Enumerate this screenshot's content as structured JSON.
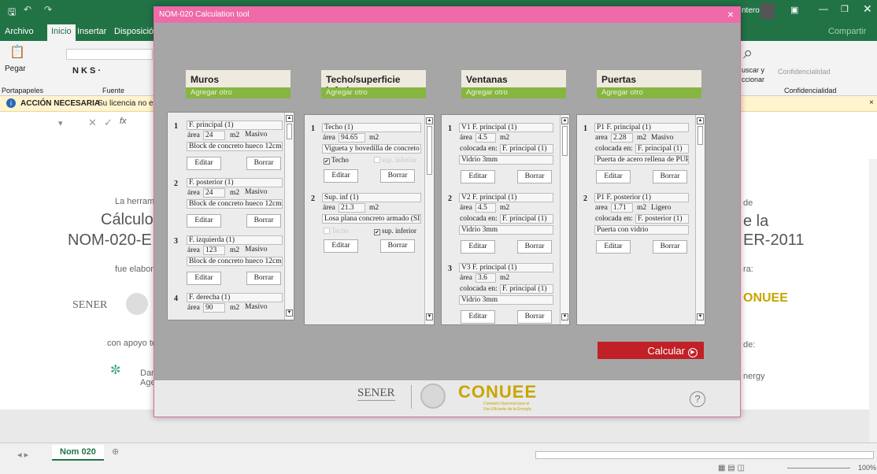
{
  "excel": {
    "tabs": [
      "Archivo",
      "Inicio",
      "Insertar",
      "Disposición d"
    ],
    "ribbon": {
      "pegar": "Pegar",
      "fuente": "Fuente",
      "portapapeles": "Portapapeles",
      "buscar1": "uscar y",
      "buscar2": "ccionar",
      "confidencialidad": "Confidencialidad",
      "confid2": "Confidencialidad",
      "compartir": "Compartir",
      "user": "ntero"
    },
    "warning": {
      "bold": "ACCIÓN NECESARIA",
      "text": "Su licencia no es o"
    },
    "sheet": {
      "l1": "La herrami",
      "l2": "Cálculo",
      "l3": "NOM-020-E",
      "l4": "fue elabora",
      "l5": "con apoyo té",
      "l6": "Dan",
      "l7": "Age",
      "r1": "de",
      "r2": "e la",
      "r3": "ER-2011",
      "r4": "ra:",
      "r5": "de:",
      "r6": "nergy",
      "sener": "SENER",
      "conuee": "ONUEE"
    },
    "sheet_tab": "Nom 020",
    "zoom": "100%"
  },
  "dialog": {
    "title": "NOM-020 Calculation tool",
    "close": "×",
    "calcular": "Calcular",
    "help": "?",
    "footer_sener": "SENER",
    "footer_conuee": "CONUEE",
    "footer_conuee_sub1": "Comisión Nacional para el",
    "footer_conuee_sub2": "Uso Eficiente de la Energía",
    "muros": {
      "title": "Muros",
      "add": "Agregar otro",
      "items": [
        {
          "n": "1",
          "name": "F. principal (1)",
          "area_label": "área",
          "area": "24",
          "unit": "m2",
          "mass": "Masivo",
          "mat": "Block de concreto hueco 12cm",
          "edit": "Editar",
          "del": "Borrar"
        },
        {
          "n": "2",
          "name": "F. posterior (1)",
          "area_label": "área",
          "area": "24",
          "unit": "m2",
          "mass": "Masivo",
          "mat": "Block de concreto hueco 12cm",
          "edit": "Editar",
          "del": "Borrar"
        },
        {
          "n": "3",
          "name": "F. izquierda (1)",
          "area_label": "área",
          "area": "123",
          "unit": "m2",
          "mass": "Masivo",
          "mat": "Block de concreto hueco 12cm",
          "edit": "Editar",
          "del": "Borrar"
        },
        {
          "n": "4",
          "name": "F. derecha (1)",
          "area_label": "área",
          "area": "90",
          "unit": "m2",
          "mass": "Masivo"
        }
      ]
    },
    "techo": {
      "title": "Techo/superficie inferior",
      "add": "Agregar otro",
      "items": [
        {
          "n": "1",
          "name": "Techo (1)",
          "area_label": "área",
          "area": "94.65",
          "unit": "m2",
          "mat": "Vigueta y bovedilla de concreto",
          "chk1": "Techo",
          "chk2": "sup. inferior",
          "edit": "Editar",
          "del": "Borrar"
        },
        {
          "n": "2",
          "name": "Sup. inf (1)",
          "area_label": "área",
          "area": "21.3",
          "unit": "m2",
          "mat": "Losa plana concreto armado (SI)",
          "chk1": "Techo",
          "chk2": "sup. inferior",
          "edit": "Editar",
          "del": "Borrar"
        }
      ]
    },
    "ventanas": {
      "title": "Ventanas",
      "add": "Agregar otro",
      "items": [
        {
          "n": "1",
          "name": "V1 F. principal (1)",
          "area_label": "área",
          "area": "4.5",
          "unit": "m2",
          "col_label": "colocada en:",
          "col": "F. principal (1)",
          "mat": "Vidrio 3mm",
          "edit": "Editar",
          "del": "Borrar"
        },
        {
          "n": "2",
          "name": "V2 F. principal (1)",
          "area_label": "área",
          "area": "4.5",
          "unit": "m2",
          "col_label": "colocada en:",
          "col": "F. principal (1)",
          "mat": "Vidrio 3mm",
          "edit": "Editar",
          "del": "Borrar"
        },
        {
          "n": "3",
          "name": "V3 F. principal (1)",
          "area_label": "área",
          "area": "3.6",
          "unit": "m2",
          "col_label": "colocada en:",
          "col": "F. principal (1)",
          "mat": "Vidrio 3mm",
          "edit": "Editar",
          "del": "Borrar"
        }
      ]
    },
    "puertas": {
      "title": "Puertas",
      "add": "Agregar otro",
      "items": [
        {
          "n": "1",
          "name": "P1 F. principal (1)",
          "area_label": "area",
          "area": "2.28",
          "unit": "m2",
          "mass": "Masivo",
          "col_label": "colocada en:",
          "col": "F. principal (1)",
          "mat": "Puerta de acero rellena de PUR",
          "edit": "Editar",
          "del": "Borrar"
        },
        {
          "n": "2",
          "name": "P1 F. posterior (1)",
          "area_label": "area",
          "area": "1.71",
          "unit": "m2",
          "mass": "Ligero",
          "col_label": "colocada en:",
          "col": "F. posterior (1)",
          "mat": "Puerta con vidrio",
          "edit": "Editar",
          "del": "Borrar"
        }
      ]
    }
  }
}
